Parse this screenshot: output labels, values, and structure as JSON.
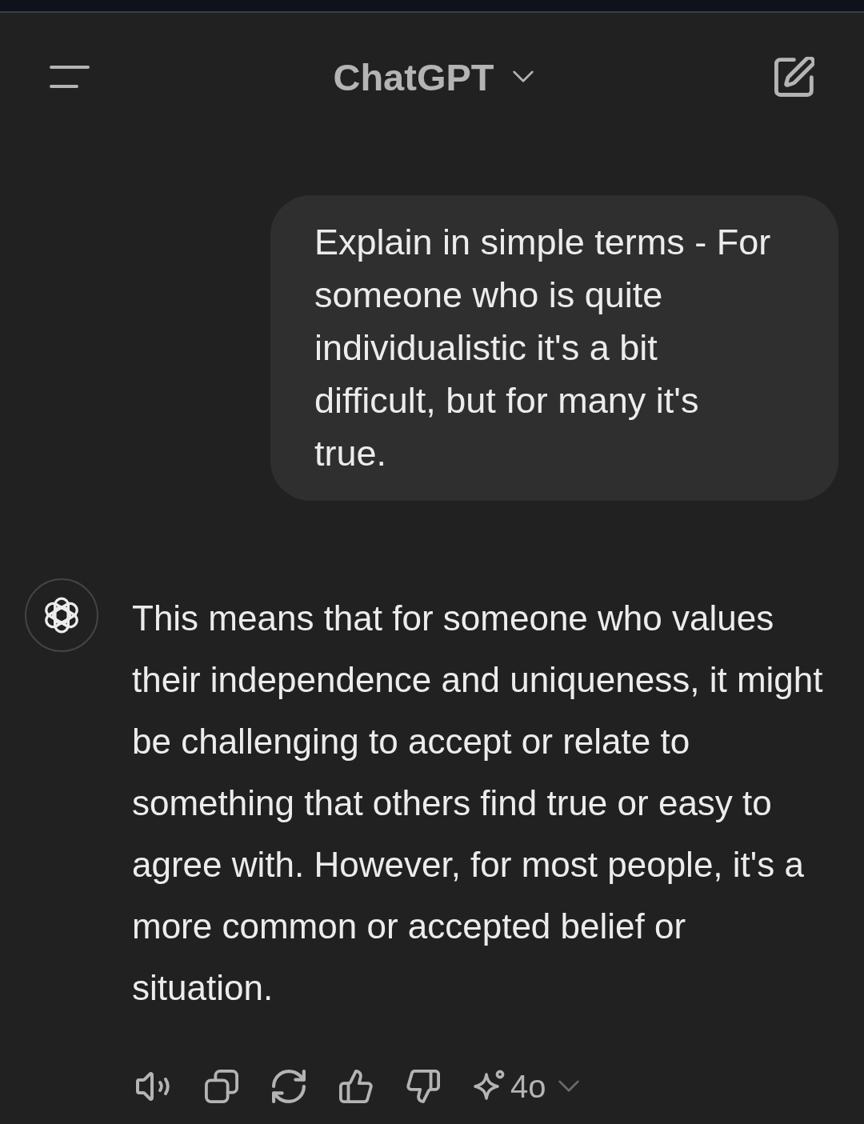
{
  "header": {
    "title": "ChatGPT"
  },
  "messages": [
    {
      "kind": "user",
      "text": "Explain in simple terms - For someone who is quite individualistic it's a bit difficult, but for many it's true."
    },
    {
      "kind": "assistant",
      "text": "This means that for someone who values their independence and uniqueness, it might be challenging to accept or relate to something that others find true or easy to agree with. However, for most people, it's a more common or accepted belief or situation."
    }
  ],
  "message_actions": {
    "model_label": "4o"
  }
}
